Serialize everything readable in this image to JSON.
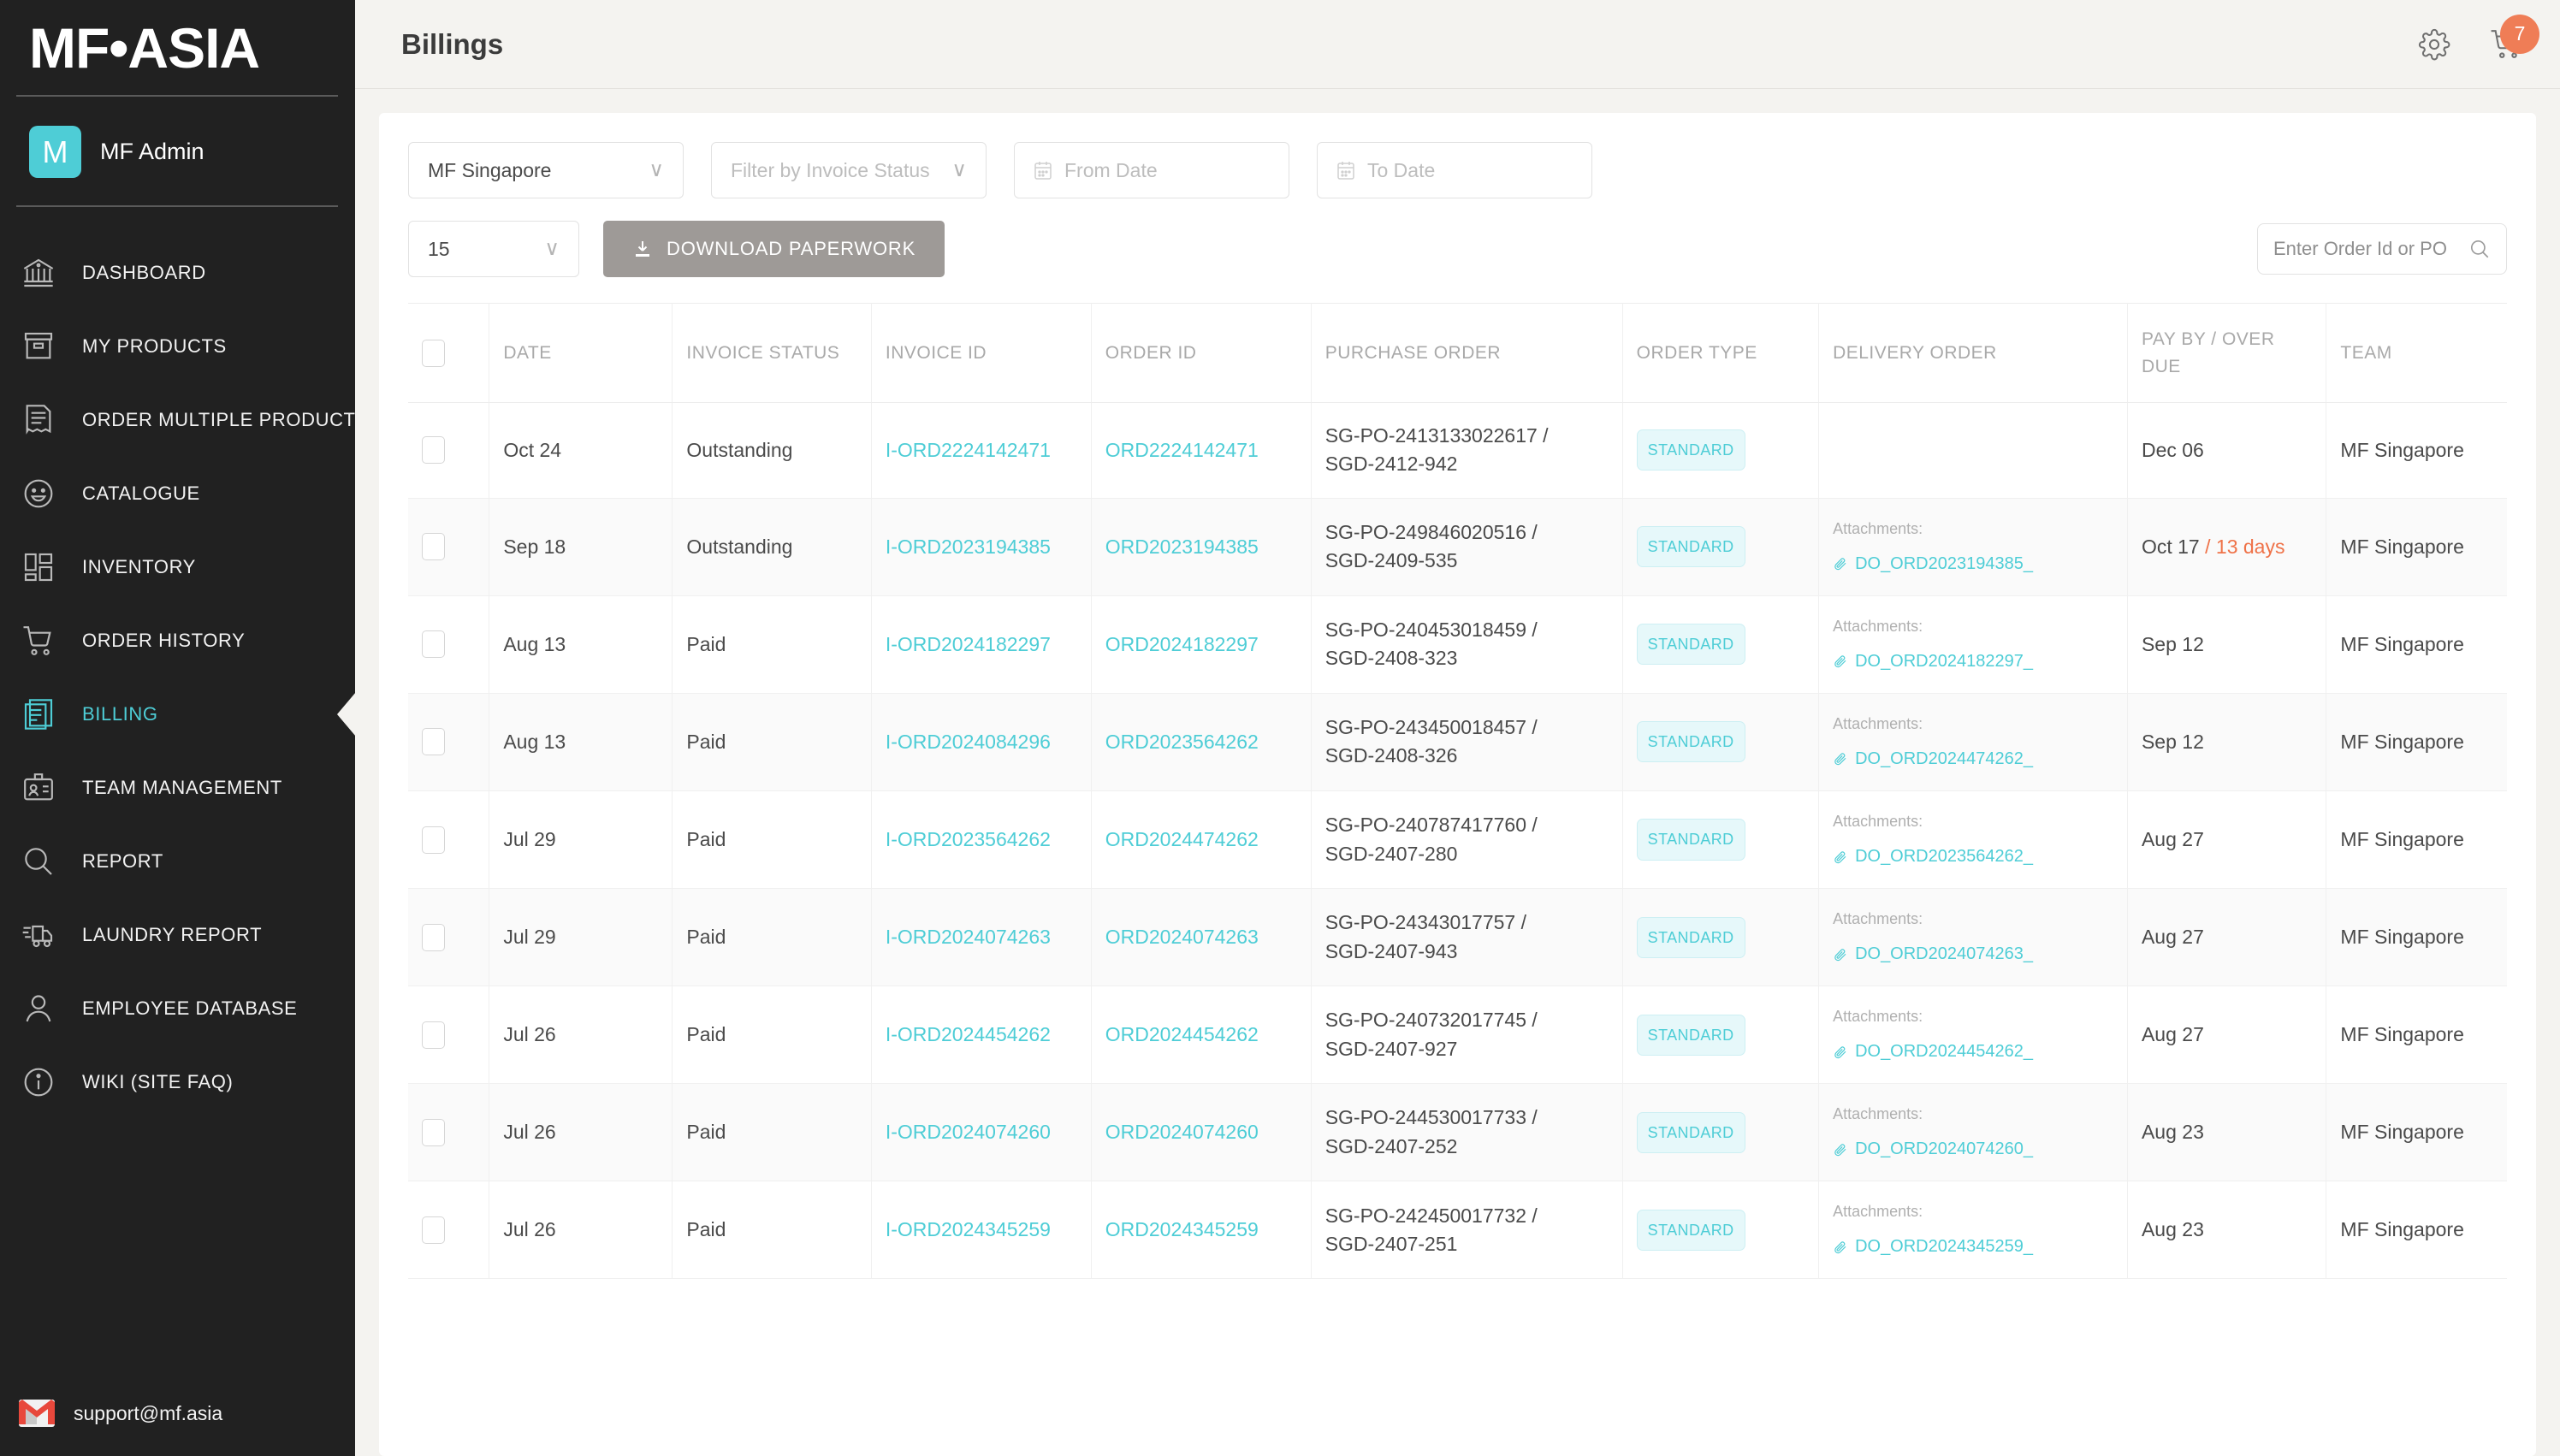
{
  "brand": {
    "logo_text": "MF•ASIA",
    "avatar_initial": "M",
    "user_name": "MF Admin"
  },
  "sidebar": {
    "items": [
      {
        "label": "DASHBOARD",
        "icon": "bank-icon",
        "active": false
      },
      {
        "label": "MY PRODUCTS",
        "icon": "box-icon",
        "active": false
      },
      {
        "label": "ORDER MULTIPLE PRODUCTS",
        "icon": "document-list-icon",
        "active": false
      },
      {
        "label": "CATALOGUE",
        "icon": "smiley-icon",
        "active": false
      },
      {
        "label": "INVENTORY",
        "icon": "grid-icon",
        "active": false
      },
      {
        "label": "ORDER HISTORY",
        "icon": "cart-icon",
        "active": false
      },
      {
        "label": "BILLING",
        "icon": "invoice-icon",
        "active": true
      },
      {
        "label": "TEAM MANAGEMENT",
        "icon": "id-badge-icon",
        "active": false
      },
      {
        "label": "REPORT",
        "icon": "magnifier-icon",
        "active": false
      },
      {
        "label": "LAUNDRY REPORT",
        "icon": "truck-icon",
        "active": false
      },
      {
        "label": "EMPLOYEE DATABASE",
        "icon": "person-icon",
        "active": false
      },
      {
        "label": "WIKI (SITE FAQ)",
        "icon": "info-icon",
        "active": false
      }
    ],
    "support_email": "support@mf.asia"
  },
  "header": {
    "title": "Billings",
    "cart_badge": "7"
  },
  "filters": {
    "company_value": "MF Singapore",
    "status_placeholder": "Filter by Invoice Status",
    "from_date_placeholder": "From Date",
    "to_date_placeholder": "To Date",
    "page_size_value": "15",
    "download_label": "DOWNLOAD PAPERWORK",
    "search_placeholder": "Enter Order Id or PO"
  },
  "table": {
    "columns": [
      "",
      "DATE",
      "INVOICE STATUS",
      "INVOICE ID",
      "ORDER ID",
      "PURCHASE ORDER",
      "ORDER TYPE",
      "DELIVERY ORDER",
      "PAY BY / OVER DUE",
      "TEAM"
    ],
    "attachments_label": "Attachments:",
    "rows": [
      {
        "date": "Oct 24",
        "status": "Outstanding",
        "invoice_id": "I-ORD2224142471",
        "order_id": "ORD2224142471",
        "po_line1": "SG-PO-2413133022617 /",
        "po_line2": "SGD-2412-942",
        "order_type": "STANDARD",
        "delivery_order": "",
        "pay_by": "Dec 06",
        "overdue": "",
        "team": "MF Singapore"
      },
      {
        "date": "Sep 18",
        "status": "Outstanding",
        "invoice_id": "I-ORD2023194385",
        "order_id": "ORD2023194385",
        "po_line1": "SG-PO-249846020516 /",
        "po_line2": "SGD-2409-535",
        "order_type": "STANDARD",
        "delivery_order": "DO_ORD2023194385_",
        "pay_by": "Oct 17",
        "overdue": "/ 13 days",
        "team": "MF Singapore"
      },
      {
        "date": "Aug 13",
        "status": "Paid",
        "invoice_id": "I-ORD2024182297",
        "order_id": "ORD2024182297",
        "po_line1": "SG-PO-240453018459 /",
        "po_line2": "SGD-2408-323",
        "order_type": "STANDARD",
        "delivery_order": "DO_ORD2024182297_",
        "pay_by": "Sep 12",
        "overdue": "",
        "team": "MF Singapore"
      },
      {
        "date": "Aug 13",
        "status": "Paid",
        "invoice_id": "I-ORD2024084296",
        "order_id": "ORD2023564262",
        "po_line1": "SG-PO-243450018457 /",
        "po_line2": "SGD-2408-326",
        "order_type": "STANDARD",
        "delivery_order": "DO_ORD2024474262_",
        "pay_by": "Sep 12",
        "overdue": "",
        "team": "MF Singapore"
      },
      {
        "date": "Jul 29",
        "status": "Paid",
        "invoice_id": "I-ORD2023564262",
        "order_id": "ORD2024474262",
        "po_line1": "SG-PO-240787417760 /",
        "po_line2": "SGD-2407-280",
        "order_type": "STANDARD",
        "delivery_order": "DO_ORD2023564262_",
        "pay_by": "Aug 27",
        "overdue": "",
        "team": "MF Singapore"
      },
      {
        "date": "Jul 29",
        "status": "Paid",
        "invoice_id": "I-ORD2024074263",
        "order_id": "ORD2024074263",
        "po_line1": "SG-PO-24343017757 /",
        "po_line2": "SGD-2407-943",
        "order_type": "STANDARD",
        "delivery_order": "DO_ORD2024074263_",
        "pay_by": "Aug 27",
        "overdue": "",
        "team": "MF Singapore"
      },
      {
        "date": "Jul 26",
        "status": "Paid",
        "invoice_id": "I-ORD2024454262",
        "order_id": "ORD2024454262",
        "po_line1": "SG-PO-240732017745 /",
        "po_line2": "SGD-2407-927",
        "order_type": "STANDARD",
        "delivery_order": "DO_ORD2024454262_",
        "pay_by": "Aug 27",
        "overdue": "",
        "team": "MF Singapore"
      },
      {
        "date": "Jul 26",
        "status": "Paid",
        "invoice_id": "I-ORD2024074260",
        "order_id": "ORD2024074260",
        "po_line1": "SG-PO-244530017733 /",
        "po_line2": "SGD-2407-252",
        "order_type": "STANDARD",
        "delivery_order": "DO_ORD2024074260_",
        "pay_by": "Aug 23",
        "overdue": "",
        "team": "MF Singapore"
      },
      {
        "date": "Jul 26",
        "status": "Paid",
        "invoice_id": "I-ORD2024345259",
        "order_id": "ORD2024345259",
        "po_line1": "SG-PO-242450017732 /",
        "po_line2": "SGD-2407-251",
        "order_type": "STANDARD",
        "delivery_order": "DO_ORD2024345259_",
        "pay_by": "Aug 23",
        "overdue": "",
        "team": "MF Singapore"
      }
    ]
  },
  "colors": {
    "accent": "#4ecdd6",
    "sidebar_bg": "#212121",
    "overdue": "#ef7248",
    "badge_bg": "#ef7d56"
  }
}
